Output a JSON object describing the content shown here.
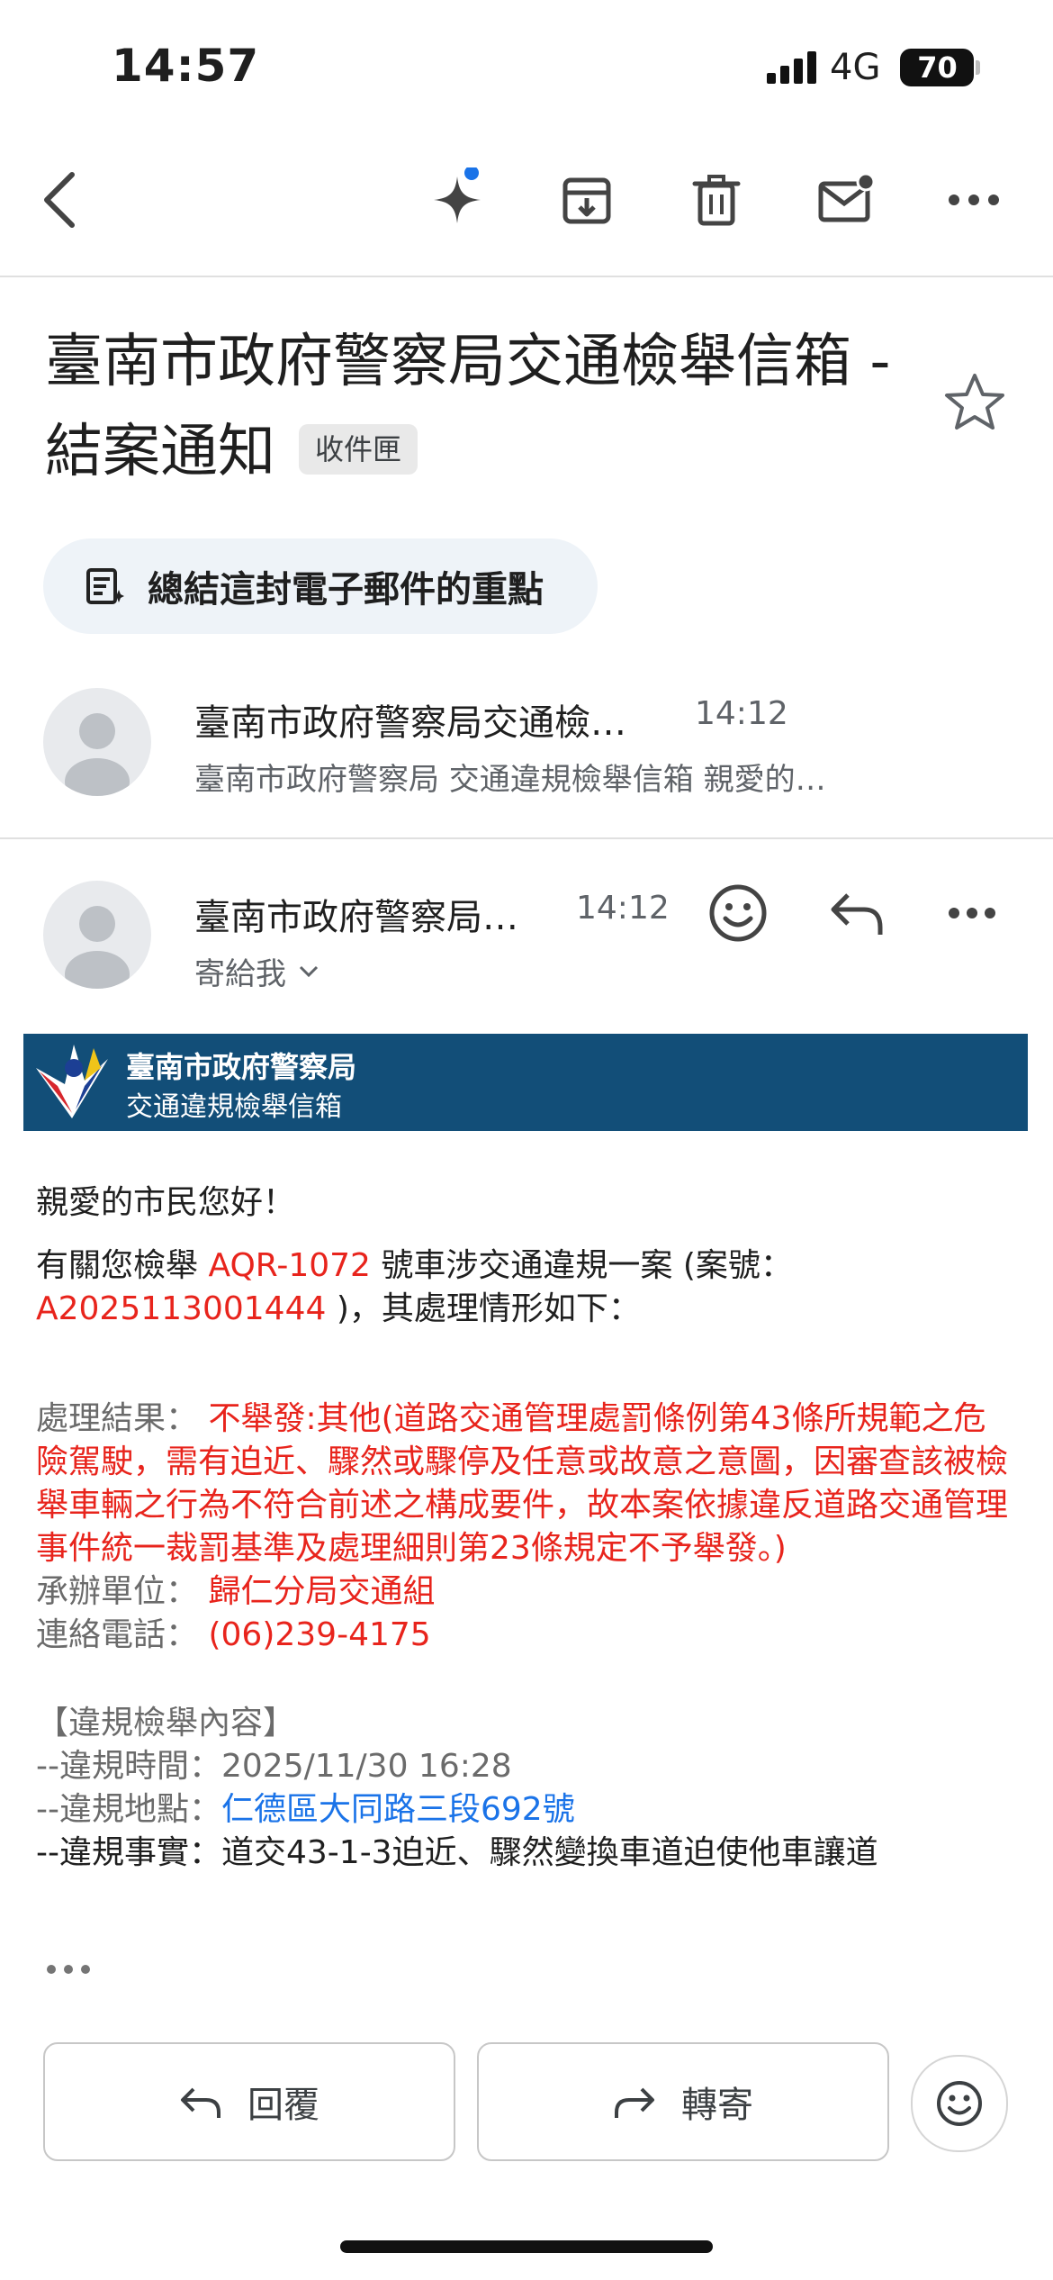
{
  "status_bar": {
    "time": "14:57",
    "network": "4G",
    "battery": "70"
  },
  "subject": {
    "title": "臺南市政府警察局交通檢舉信箱 - 結案通知",
    "label": "收件匣"
  },
  "summary_chip": {
    "label": "總結這封電子郵件的重點"
  },
  "thread_message_1": {
    "sender": "臺南市政府警察局交通檢…",
    "time": "14:12",
    "snippet": "臺南市政府警察局 交通違規檢舉信箱 親愛的…"
  },
  "thread_message_2": {
    "sender": "臺南市政府警察局…",
    "time": "14:12",
    "recipient": "寄給我"
  },
  "banner": {
    "line1": "臺南市政府警察局",
    "line2": "交通違規檢舉信箱"
  },
  "email_body": {
    "greeting": "親愛的市民您好！",
    "intro_prefix": "有關您檢舉 ",
    "plate": "AQR-1072",
    "intro_mid": " 號車涉交通違規一案 (案號：",
    "case_no": "A2025113001444",
    "intro_suffix": " )，其處理情形如下：",
    "result_label": "處理結果：",
    "result_text": "不舉發:其他(道路交通管理處罰條例第43條所規範之危險駕駛，需有迫近、驟然或驟停及任意或故意之意圖，因審查該被檢舉車輛之行為不符合前述之構成要件，故本案依據違反道路交通管理事件統一裁罰基準及處理細則第23條規定不予舉發。)",
    "unit_label": "承辦單位：",
    "unit_value": "歸仁分局交通組",
    "phone_label": "連絡電話：",
    "phone_value": "(06)239-4175",
    "section_title": "【違規檢舉內容】",
    "time_label": "--違規時間：",
    "time_value": "2025/11/30 16:28",
    "location_label": "--違規地點：",
    "location_value": "仁德區大同路三段692號",
    "fact_label": "--違規事實：",
    "fact_value": "道交43-1-3迫近、驟然變換車道迫使他車讓道"
  },
  "actions": {
    "reply": "回覆",
    "forward": "轉寄"
  },
  "colors": {
    "accent_red": "#e8241c",
    "link_blue": "#1a73e8",
    "banner_blue": "#124e78"
  }
}
